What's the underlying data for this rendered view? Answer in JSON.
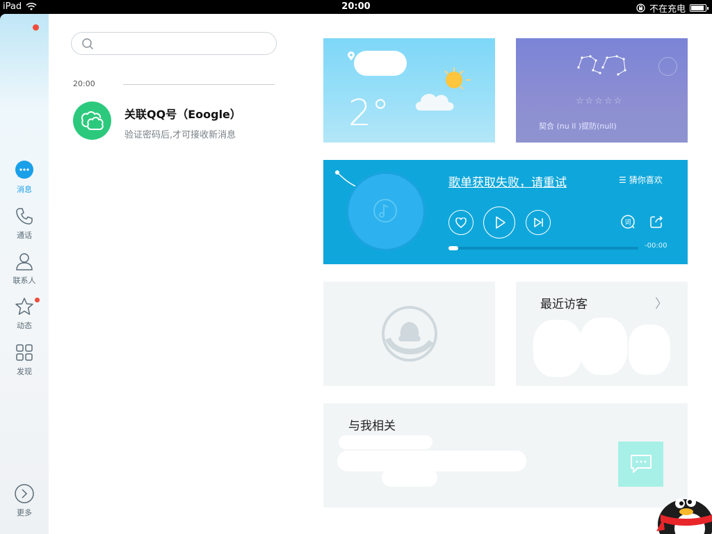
{
  "status_bar": {
    "device": "iPad",
    "time": "20:00",
    "charging_text": "不在充电"
  },
  "nav": {
    "items": [
      {
        "label": "消息",
        "icon": "chat-bubble-icon",
        "active": true
      },
      {
        "label": "通话",
        "icon": "phone-icon"
      },
      {
        "label": "联系人",
        "icon": "contact-icon"
      },
      {
        "label": "动态",
        "icon": "star-icon"
      },
      {
        "label": "发现",
        "icon": "grid-icon"
      }
    ],
    "more_label": "更多"
  },
  "chat_list": {
    "search_placeholder": "",
    "time_divider": "20:00",
    "conversation": {
      "title": "关联QQ号（Eoogle）",
      "subtitle": "验证密码后,才可接收新消息"
    }
  },
  "dashboard": {
    "weather": {
      "temperature": "2°"
    },
    "horoscope": {
      "meta": "契合  (nu         ll  )提防(null)",
      "rating_stars": "☆☆☆☆☆"
    },
    "music": {
      "error_text": "歌单获取失败，请重试",
      "guess_label": "猜你喜欢",
      "duration": "-00:00",
      "progress": 0.0
    },
    "visitors": {
      "title": "最近访客"
    },
    "related": {
      "title": "与我相关"
    }
  },
  "colors": {
    "accent": "#1aa0e8",
    "music_card": "#0fa7db",
    "weather_card": "#7ed7f8",
    "horoscope_card": "#7a84d6",
    "avatar_green": "#2cc97d"
  }
}
